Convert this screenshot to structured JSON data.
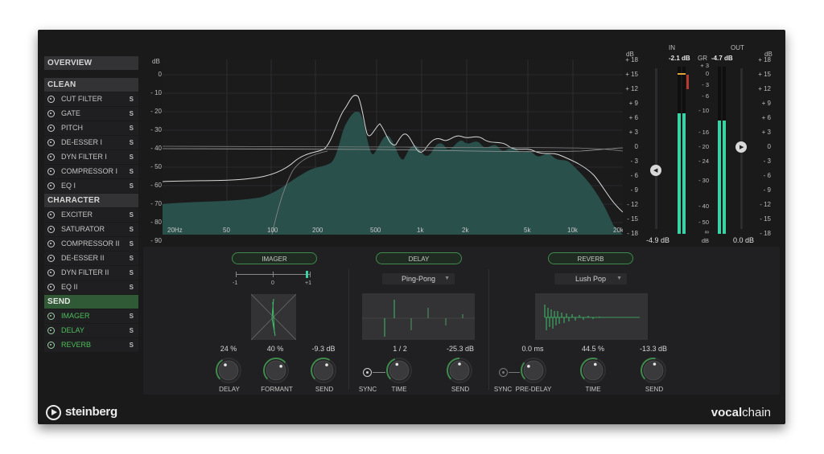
{
  "sidebar": {
    "overview": "OVERVIEW",
    "clean": {
      "title": "CLEAN",
      "items": [
        "CUT FILTER",
        "GATE",
        "PITCH",
        "DE-ESSER I",
        "DYN FILTER I",
        "COMPRESSOR I",
        "EQ I"
      ]
    },
    "character": {
      "title": "CHARACTER",
      "items": [
        "EXCITER",
        "SATURATOR",
        "COMPRESSOR II",
        "DE-ESSER II",
        "DYN FILTER II",
        "EQ II"
      ]
    },
    "send": {
      "title": "SEND",
      "items": [
        "IMAGER",
        "DELAY",
        "REVERB"
      ]
    },
    "solo_label": "S"
  },
  "analyzer": {
    "left_unit": "dB",
    "left_scale": [
      "0",
      "- 10",
      "- 20",
      "- 30",
      "- 40",
      "- 50",
      "- 60",
      "- 70",
      "- 80",
      "- 90"
    ],
    "right_unit": "dB",
    "right_scale": [
      "+ 18",
      "+ 15",
      "+ 12",
      "+ 9",
      "+ 6",
      "+ 3",
      "0",
      "- 3",
      "- 6",
      "- 9",
      "- 12",
      "- 15",
      "- 18"
    ],
    "freq_labels": [
      "20Hz",
      "50",
      "100",
      "200",
      "500",
      "1k",
      "2k",
      "5k",
      "10k",
      "20k"
    ]
  },
  "meters": {
    "in_label": "IN",
    "gr_label": "GR",
    "out_label": "OUT",
    "in_value": "-2.1 dB",
    "out_value": "-4.7 dB",
    "gr_scale": [
      "+ 3",
      "0",
      "- 3",
      "- 6",
      "- 10",
      "- 16",
      "- 20",
      "- 24",
      "- 30",
      "- 40",
      "- 50",
      "∞"
    ],
    "gr_unit": "dB",
    "in_gain": "-4.9 dB",
    "out_gain": "0.0 dB",
    "in_level": 0.72,
    "out_level": 0.68,
    "out_unit": "dB",
    "out_scale": [
      "+ 18",
      "+ 15",
      "+ 12",
      "+ 9",
      "+ 6",
      "+ 3",
      "0",
      "- 3",
      "- 6",
      "- 9",
      "- 12",
      "- 15",
      "- 18"
    ]
  },
  "imager": {
    "title": "IMAGER",
    "width_ticks": [
      "-1",
      "0",
      "+1"
    ],
    "delay_value": "24 %",
    "formant_value": "40 %",
    "send_value": "-9.3 dB",
    "delay_label": "DELAY",
    "formant_label": "FORMANT",
    "send_label": "SEND"
  },
  "delay": {
    "title": "DELAY",
    "mode": "Ping-Pong",
    "time_value": "1 / 2",
    "send_value": "-25.3 dB",
    "sync_label": "SYNC",
    "time_label": "TIME",
    "send_label": "SEND"
  },
  "reverb": {
    "title": "REVERB",
    "preset": "Lush Pop",
    "predelay_value": "0.0 ms",
    "time_value": "44.5 %",
    "send_value": "-13.3 dB",
    "sync_label": "SYNC",
    "predelay_label": "PRE-DELAY",
    "time_label": "TIME",
    "send_label": "SEND"
  },
  "brand": {
    "name": "steinberg",
    "product_a": "vocal",
    "product_b": "chain"
  },
  "colors": {
    "accent": "#3f8a4c",
    "meter": "#3ad1a4",
    "spectrum": "#2e5a55"
  }
}
